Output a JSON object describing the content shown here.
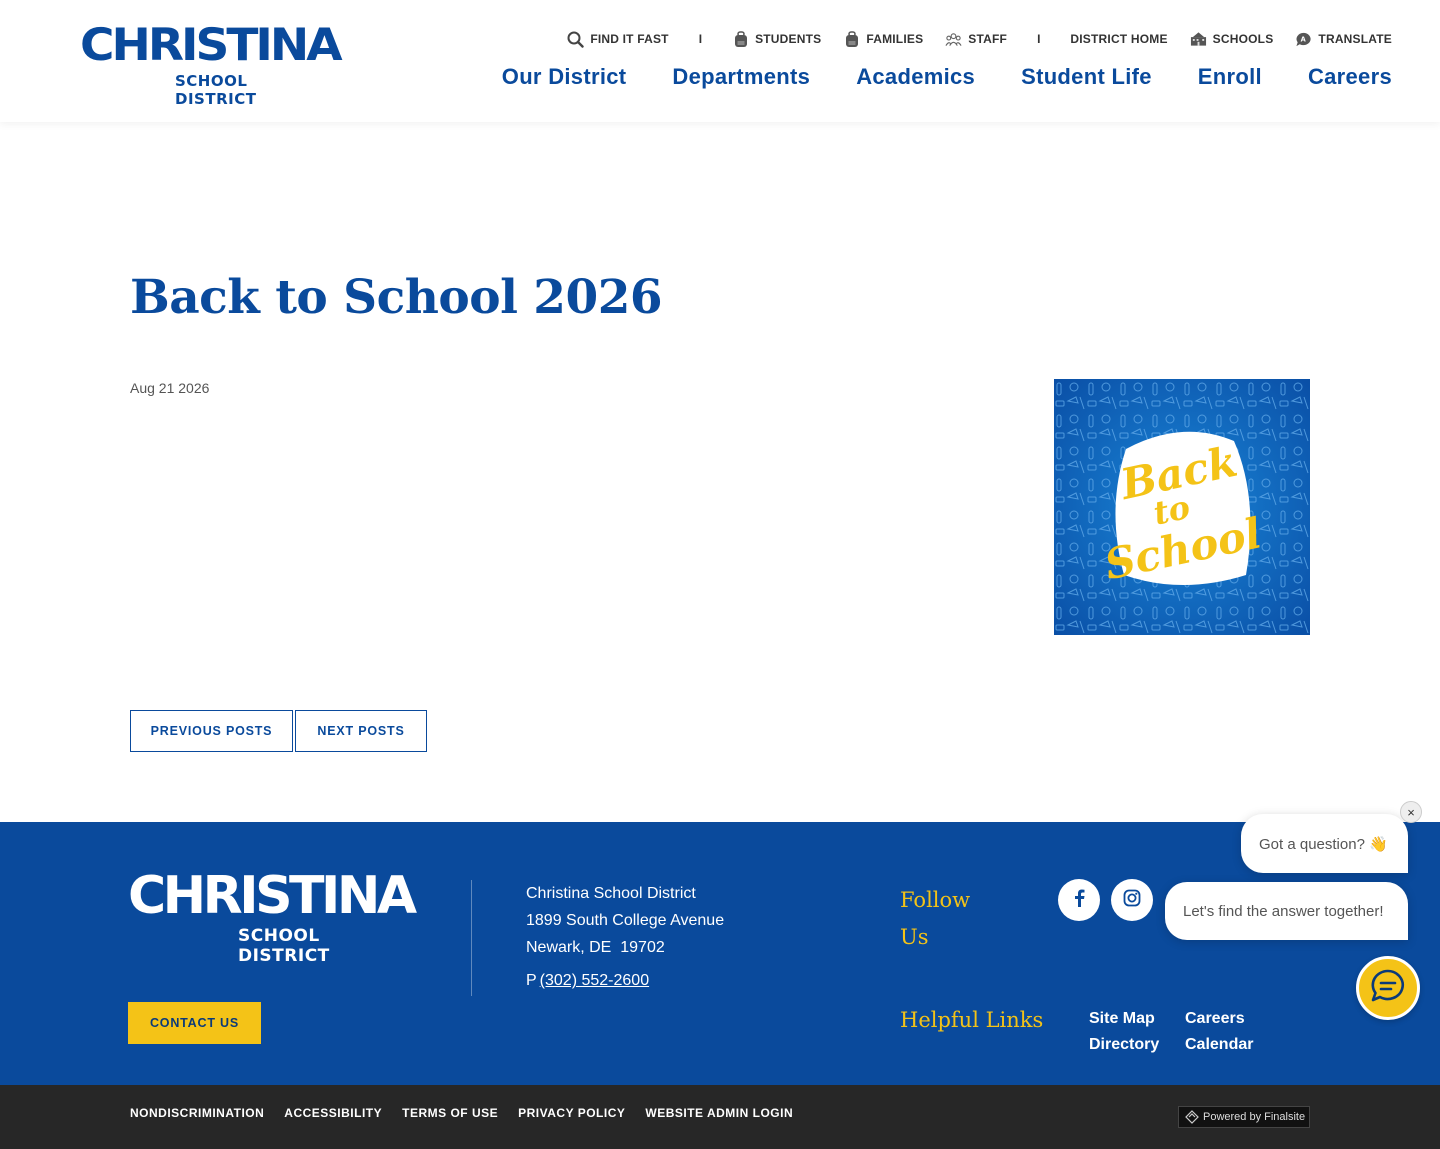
{
  "header": {
    "logo": {
      "line1": "CHRISTINA",
      "line2": "SCHOOL DISTRICT"
    },
    "utility": [
      {
        "label": "FIND IT FAST",
        "icon": "search-icon"
      },
      {
        "label": "STUDENTS",
        "icon": "backpack-icon"
      },
      {
        "label": "FAMILIES",
        "icon": "backpack-icon"
      },
      {
        "label": "STAFF",
        "icon": "people-icon"
      },
      {
        "label": "DISTRICT HOME",
        "icon": ""
      },
      {
        "label": "SCHOOLS",
        "icon": "school-building-icon"
      },
      {
        "label": "TRANSLATE",
        "icon": "translate-chat-icon"
      }
    ],
    "separator": "I",
    "nav": [
      "Our District",
      "Departments",
      "Academics",
      "Student Life",
      "Enroll",
      "Careers"
    ]
  },
  "post": {
    "title": "Back to School 2026",
    "date": "Aug 21 2026",
    "image_text": [
      "Back",
      "to",
      "School"
    ]
  },
  "pager": {
    "prev": "PREVIOUS POSTS",
    "next": "NEXT POSTS"
  },
  "footer": {
    "logo": {
      "line1": "CHRISTINA",
      "line2": "SCHOOL DISTRICT"
    },
    "contact_label": "CONTACT US",
    "address": [
      "Christina School District",
      "1899 South College Avenue",
      "Newark, DE  19702"
    ],
    "phone_prefix": "P",
    "phone": "(302) 552-2600",
    "follow_heading": "Follow Us",
    "social": [
      "facebook-icon",
      "instagram-icon"
    ],
    "helpful_heading": "Helpful Links",
    "links": [
      "Site Map",
      "Careers",
      "Directory",
      "Calendar"
    ]
  },
  "bottom": {
    "links": [
      "NONDISCRIMINATION",
      "ACCESSIBILITY",
      "TERMS OF USE",
      "PRIVACY POLICY",
      "WEBSITE ADMIN LOGIN"
    ],
    "powered": "Powered by Finalsite"
  },
  "chat": {
    "close": "×",
    "message1": "Got a question? 👋",
    "message2": "Let's find the answer together!"
  },
  "colors": {
    "brand_blue": "#0a4a9c",
    "accent_yellow": "#f4c317",
    "bottom_bar": "#272727"
  }
}
